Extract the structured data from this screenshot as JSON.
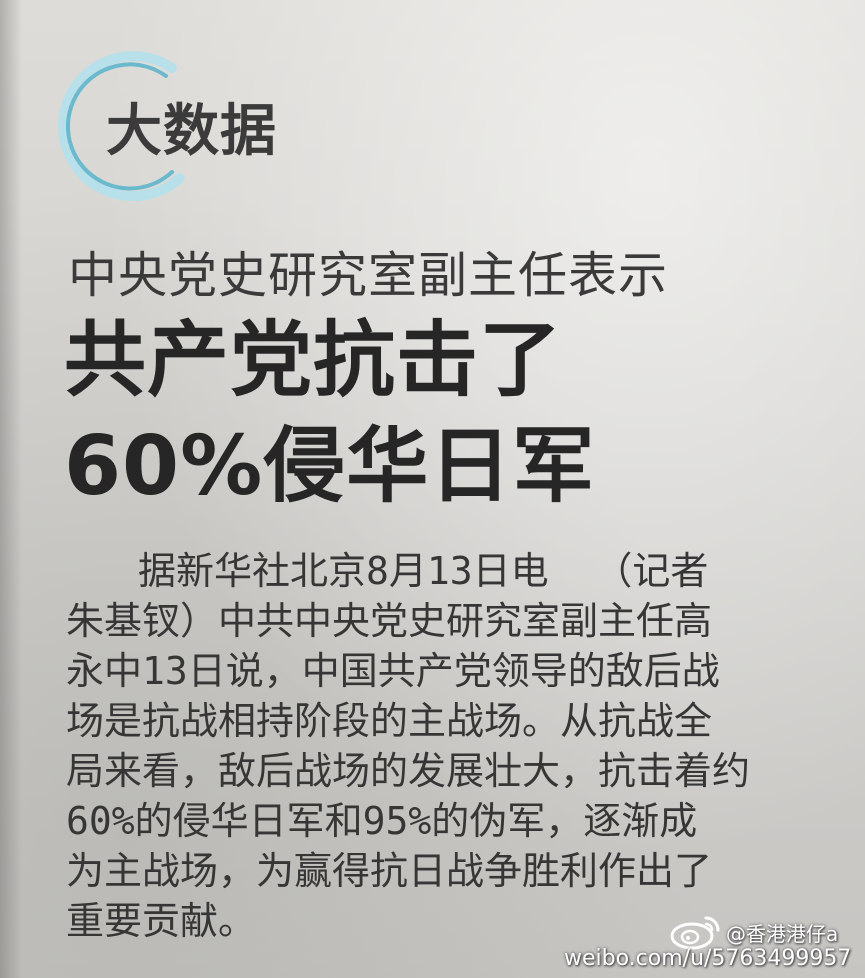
{
  "article": {
    "column_label": "大数据",
    "subheadline": "中央党史研究室副主任表示",
    "headline": [
      "共产党抗击了",
      "60%侵华日军"
    ],
    "body_lines": [
      "据新华社北京8月13日电  （记者",
      "朱基钗）中共中央党史研究室副主任高",
      "永中13日说，中国共产党领导的敌后战",
      "场是抗战相持阶段的主战场。从抗战全",
      "局来看，敌后战场的发展壮大，抗击着约",
      "60%的侵华日军和95%的伪军，逐渐成",
      "为主战场，为赢得抗日战争胜利作出了",
      "重要贡献。"
    ]
  },
  "watermark": {
    "handle": "@香港港仔a",
    "url": "weibo.com/u/5763499957",
    "icon": "weibo-logo-icon"
  },
  "colors": {
    "paper": "#d6d5d2",
    "ink": "#2b2b2b",
    "swirl_accent": "#7fc3d3"
  }
}
